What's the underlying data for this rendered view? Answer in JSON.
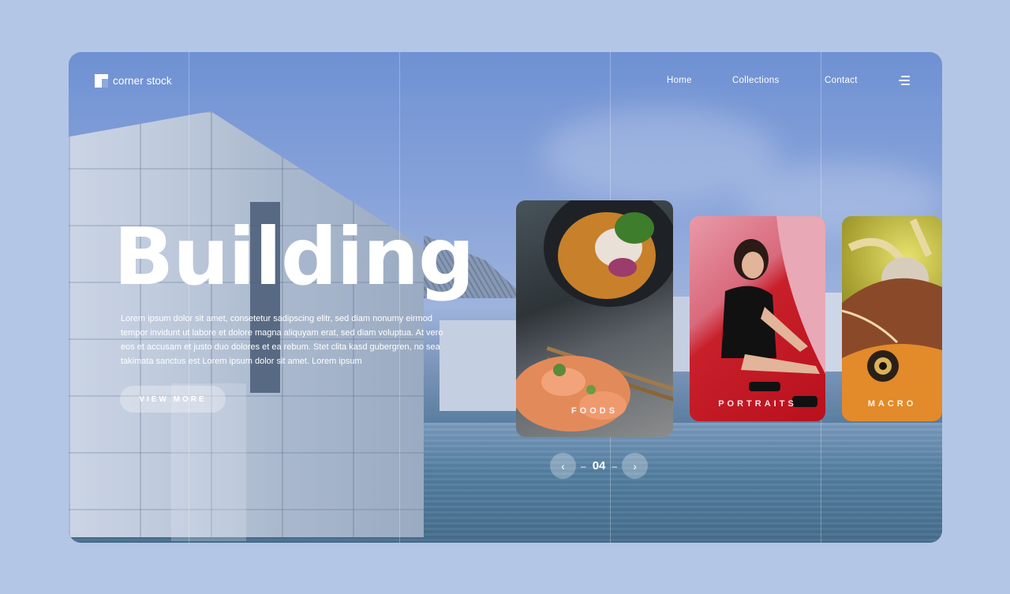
{
  "brand": {
    "name": "corner stock",
    "logo_icon": "corner-stock-logo-icon"
  },
  "nav": {
    "items": [
      "Home",
      "Collections",
      "Contact"
    ],
    "menu_icon": "hamburger-icon"
  },
  "hero": {
    "title": "Building",
    "description": "Lorem ipsum dolor sit amet, consetetur sadipscing elitr, sed diam nonumy eirmod tempor invidunt ut labore et dolore magna aliquyam erat, sed diam voluptua. At vero eos et accusam et justo duo dolores et ea rebum. Stet clita kasd gubergren, no sea takimata sanctus est Lorem ipsum dolor sit amet. Lorem ipsum",
    "cta_label": "VIEW MORE"
  },
  "cards": [
    {
      "label": "FOODS"
    },
    {
      "label": "PORTRAITS"
    },
    {
      "label": "MACRO"
    }
  ],
  "pager": {
    "prev_icon": "chevron-left-icon",
    "next_icon": "chevron-right-icon",
    "page": "04",
    "dash": "–"
  },
  "colors": {
    "page_bg": "#b3c6e5",
    "text": "#ffffff"
  }
}
